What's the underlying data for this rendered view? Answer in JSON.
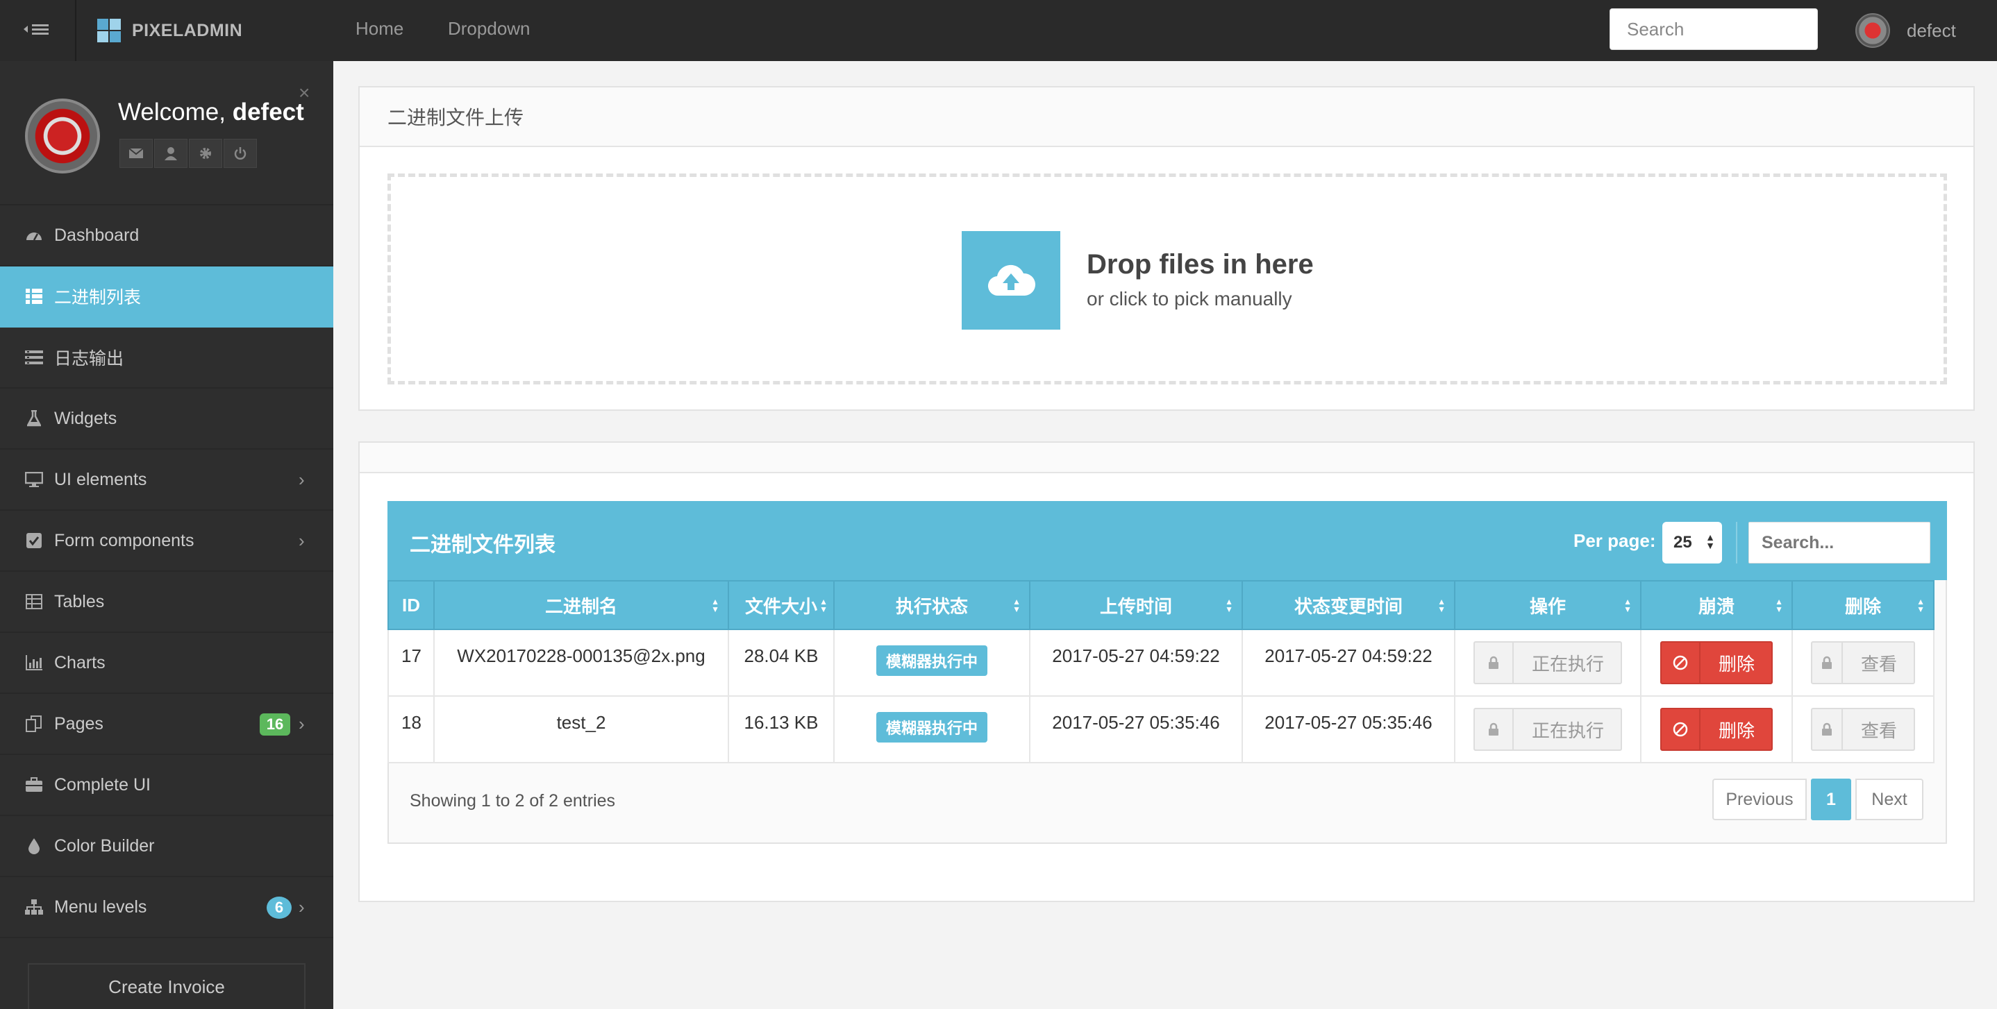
{
  "navbar": {
    "brand": "PIXELADMIN",
    "links": [
      "Home",
      "Dropdown"
    ],
    "search_placeholder": "Search",
    "user_name": "defect"
  },
  "sidebar": {
    "welcome_prefix": "Welcome, ",
    "user_name": "defect",
    "close_glyph": "×",
    "items": [
      {
        "label": "Dashboard",
        "icon": "dashboard-icon"
      },
      {
        "label": "二进制列表",
        "icon": "grid-icon",
        "active": true
      },
      {
        "label": "日志输出",
        "icon": "log-icon"
      },
      {
        "label": "Widgets",
        "icon": "flask-icon"
      },
      {
        "label": "UI elements",
        "icon": "desktop-icon",
        "chevron": true
      },
      {
        "label": "Form components",
        "icon": "checkbox-icon",
        "chevron": true
      },
      {
        "label": "Tables",
        "icon": "table-icon"
      },
      {
        "label": "Charts",
        "icon": "bar-chart-icon"
      },
      {
        "label": "Pages",
        "icon": "copy-icon",
        "badge": "16",
        "chevron": true
      },
      {
        "label": "Complete UI",
        "icon": "briefcase-icon"
      },
      {
        "label": "Color Builder",
        "icon": "tint-icon"
      },
      {
        "label": "Menu levels",
        "icon": "sitemap-icon",
        "badge": "6",
        "chevron": true
      }
    ],
    "create_invoice": "Create Invoice"
  },
  "upload": {
    "title": "二进制文件上传",
    "drop_title": "Drop files in here",
    "drop_sub": "or click to pick manually"
  },
  "table": {
    "title": "二进制文件列表",
    "per_page_label": "Per page:",
    "per_page_value": "25",
    "search_placeholder": "Search...",
    "columns": [
      "ID",
      "二进制名",
      "文件大小",
      "执行状态",
      "上传时间",
      "状态变更时间",
      "操作",
      "崩溃",
      "删除"
    ],
    "rows": [
      {
        "id": "17",
        "name": "WX20170228-000135@2x.png",
        "size": "28.04 KB",
        "status": "模糊器执行中",
        "uploaded": "2017-05-27 04:59:22",
        "changed": "2017-05-27 04:59:22",
        "op": "正在执行",
        "crash": "删除",
        "del": "查看"
      },
      {
        "id": "18",
        "name": "test_2",
        "size": "16.13 KB",
        "status": "模糊器执行中",
        "uploaded": "2017-05-27 05:35:46",
        "changed": "2017-05-27 05:35:46",
        "op": "正在执行",
        "crash": "删除",
        "del": "查看"
      }
    ],
    "showing": "Showing 1 to 2 of 2 entries",
    "pager": {
      "prev": "Previous",
      "page": "1",
      "next": "Next"
    }
  },
  "colors": {
    "accent": "#5ebcd9",
    "danger": "#e0463c",
    "success": "#5cb85c",
    "navbar": "#2a2a2a",
    "sidebar": "#2e2e2e"
  }
}
